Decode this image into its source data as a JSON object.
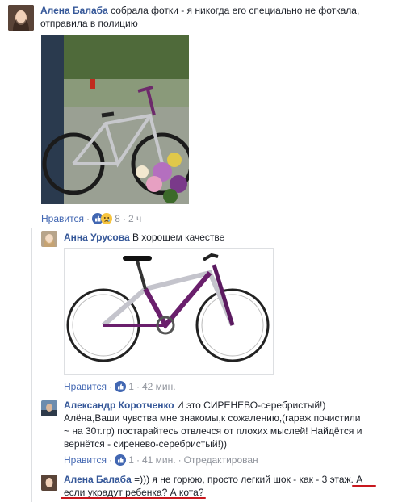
{
  "comment1": {
    "author": "Алена Балаба",
    "line1": "собрала фотки - я никогда его специально не фоткала,",
    "line2": "отправила в полицию",
    "like_label": "Нравится",
    "reaction_count": "8",
    "time": "2 ч"
  },
  "reply1": {
    "author": "Анна Урусова",
    "text": "В хорошем качестве",
    "like_label": "Нравится",
    "reaction_count": "1",
    "time": "42 мин."
  },
  "reply2": {
    "author": "Александр Коротченко",
    "line1": "И это СИРЕНЕВО-серебристый!)",
    "line2": "Алёна,Ваши чувства мне знакомы,к сожалению,(гараж почистили",
    "line3": "~ на 30т.гр) постарайтесь отвлечся от плохих мыслей! Найдётся и",
    "line4": "вернётся - сиренево-серебристый!))",
    "like_label": "Нравится",
    "reaction_count": "1",
    "time": "41 мин.",
    "edited_label": "Отредактирован"
  },
  "reply3": {
    "author": "Алена Балаба",
    "line1": "=))) я не горюю, просто легкий шок - как - 3 этаж",
    "line1_tail": ". А",
    "line2": "если украдут ребенка? А кота?"
  },
  "icons": [
    "like-icon",
    "sad-icon"
  ],
  "colors": {
    "name": "#365899",
    "meta": "#90949c",
    "like": "#4267b2",
    "underline": "#c8181e"
  }
}
